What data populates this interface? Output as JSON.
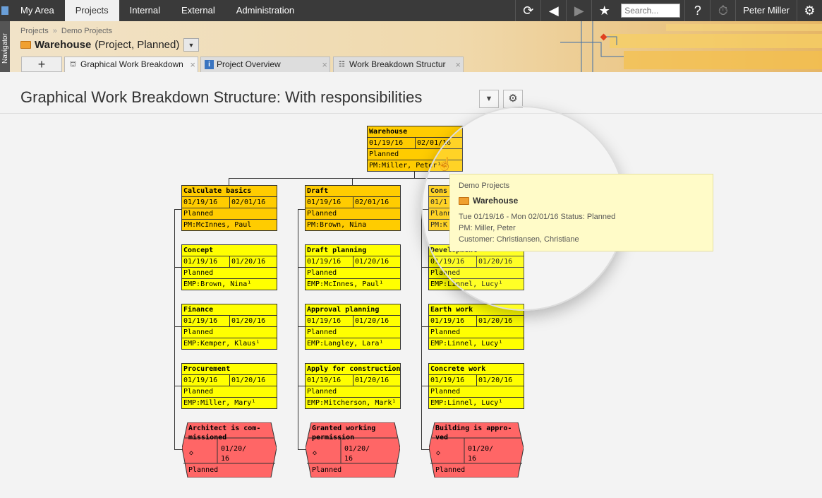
{
  "topnav": {
    "tabs": [
      "My Area",
      "Projects",
      "Internal",
      "External",
      "Administration"
    ],
    "active_tab": "Projects",
    "search_placeholder": "Search...",
    "user": "Peter Miller"
  },
  "navigator": {
    "label": "Navigator"
  },
  "header": {
    "breadcrumb": [
      "Projects",
      "Demo Projects"
    ],
    "project_name": "Warehouse",
    "project_meta": "(Project, Planned)"
  },
  "tabs": [
    {
      "label": "Graphical Work Breakdown",
      "icon": "hierarchy-icon"
    },
    {
      "label": "Project Overview",
      "icon": "info-icon"
    },
    {
      "label": "Work Breakdown Structur",
      "icon": "tree-icon"
    }
  ],
  "page": {
    "title": "Graphical Work Breakdown Structure: With responsibilities"
  },
  "wbs": {
    "root": {
      "name": "Warehouse",
      "start": "01/19/16",
      "end": "02/01/16",
      "status": "Planned",
      "resp": "PM:Miller, Peter¹"
    },
    "columns": [
      {
        "header": {
          "name": "Calculate basics",
          "start": "01/19/16",
          "end": "02/01/16",
          "status": "Planned",
          "resp": "PM:McInnes, Paul"
        },
        "children": [
          {
            "name": "Concept",
            "start": "01/19/16",
            "end": "01/20/16",
            "status": "Planned",
            "resp": "EMP:Brown, Nina¹"
          },
          {
            "name": "Finance",
            "start": "01/19/16",
            "end": "01/20/16",
            "status": "Planned",
            "resp": "EMP:Kemper, Klaus¹"
          },
          {
            "name": "Procurement",
            "start": "01/19/16",
            "end": "01/20/16",
            "status": "Planned",
            "resp": "EMP:Miller, Mary¹"
          }
        ],
        "milestone": {
          "line1": "Architect is com-",
          "line2": "missioned",
          "date1": "01/20/",
          "date2": "16",
          "status": "Planned"
        }
      },
      {
        "header": {
          "name": "Draft",
          "start": "01/19/16",
          "end": "02/01/16",
          "status": "Planned",
          "resp": "PM:Brown, Nina"
        },
        "children": [
          {
            "name": "Draft planning",
            "start": "01/19/16",
            "end": "01/20/16",
            "status": "Planned",
            "resp": "EMP:McInnes, Paul¹"
          },
          {
            "name": "Approval planning",
            "start": "01/19/16",
            "end": "01/20/16",
            "status": "Planned",
            "resp": "EMP:Langley, Lara¹"
          },
          {
            "name": "Apply for construction",
            "start": "01/19/16",
            "end": "01/20/16",
            "status": "Planned",
            "resp": "EMP:Mitcherson, Mark¹"
          }
        ],
        "milestone": {
          "line1": "Granted working",
          "line2": "permission",
          "date1": "01/20/",
          "date2": "16",
          "status": "Planned"
        }
      },
      {
        "header": {
          "name": "Cons",
          "start": "01/1",
          "end": "",
          "status": "Plann",
          "resp": "PM:K"
        },
        "children": [
          {
            "name": "Development",
            "start": "01/19/16",
            "end": "01/20/16",
            "status": "Planned",
            "resp": "EMP:Linnel, Lucy¹"
          },
          {
            "name": "Earth work",
            "start": "01/19/16",
            "end": "01/20/16",
            "status": "Planned",
            "resp": "EMP:Linnel, Lucy¹"
          },
          {
            "name": "Concrete work",
            "start": "01/19/16",
            "end": "01/20/16",
            "status": "Planned",
            "resp": "EMP:Linnel, Lucy¹"
          }
        ],
        "milestone": {
          "line1": "Building is appro-",
          "line2": "ved",
          "date1": "01/20/",
          "date2": "16",
          "status": "Planned"
        }
      }
    ]
  },
  "tooltip": {
    "parent": "Demo Projects",
    "title": "Warehouse",
    "dates_status": "Tue 01/19/16 - Mon 02/01/16   Status: Planned",
    "pm": "PM: Miller, Peter",
    "customer": "Customer: Christiansen, Christiane"
  }
}
